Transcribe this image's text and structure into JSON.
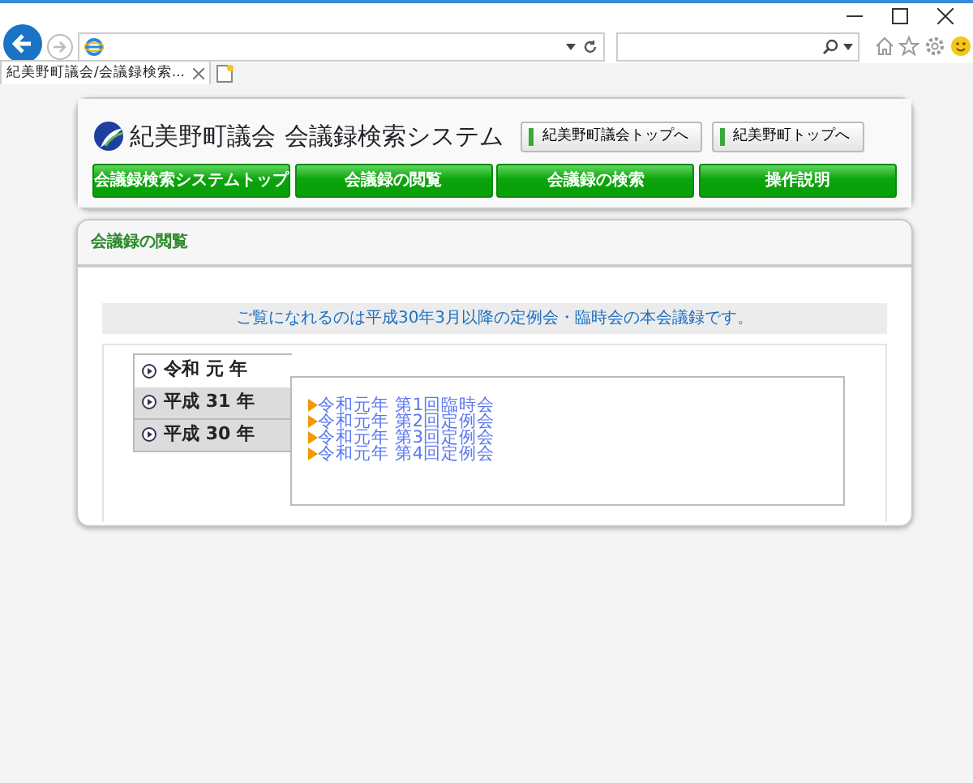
{
  "browser": {
    "tab_title": "紀美野町議会/会議録検索..."
  },
  "header": {
    "site_name": "紀美野町議会",
    "system_name": "会議録検索システム",
    "links": [
      "紀美野町議会トップへ",
      "紀美野町トップへ"
    ],
    "nav": [
      "会議録検索システムトップ",
      "会議録の閲覧",
      "会議録の検索",
      "操作説明"
    ]
  },
  "section": {
    "title": "会議録の閲覧",
    "notice": "ご覧になれるのは平成30年3月以降の定例会・臨時会の本会議録です。",
    "years": [
      {
        "label": "令和 元 年",
        "selected": true
      },
      {
        "label": "平成 31 年",
        "selected": false
      },
      {
        "label": "平成 30 年",
        "selected": false
      }
    ],
    "meetings": [
      "令和元年 第1回臨時会",
      "令和元年 第2回定例会",
      "令和元年 第3回定例会",
      "令和元年 第4回定例会"
    ]
  }
}
